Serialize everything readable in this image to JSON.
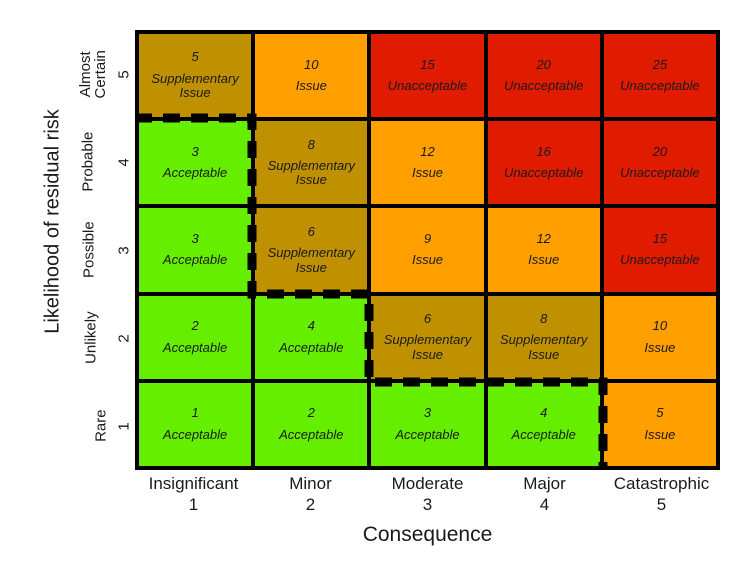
{
  "figure": {
    "y_axis_title": "Likelihood of residual risk",
    "x_axis_title": "Consequence"
  },
  "chart_data": {
    "type": "heatmap",
    "title": "",
    "xlabel": "Consequence",
    "ylabel": "Likelihood of residual risk",
    "grid": true,
    "legend": "none",
    "x_categories": [
      "Insignificant",
      "Minor",
      "Moderate",
      "Major",
      "Catastrophic"
    ],
    "x_values": [
      "1",
      "2",
      "3",
      "4",
      "5"
    ],
    "y_categories": [
      "Almost\nCertain",
      "Probable",
      "Possible",
      "Unlikely",
      "Rare"
    ],
    "y_values": [
      "5",
      "4",
      "3",
      "2",
      "1"
    ],
    "colors": {
      "acceptable": "#66ee00",
      "supplementary_issue": "#bf9000",
      "issue": "#ffa000",
      "unacceptable": "#e01b00",
      "grid_line": "#000000",
      "boundary_line": "#000000"
    },
    "rows": [
      {
        "likelihood": "Almost Certain",
        "likelihood_value": "5",
        "cells": [
          {
            "score": "5",
            "verdict": "Supplementary\nIssue",
            "level": "supplementary_issue"
          },
          {
            "score": "10",
            "verdict": "Issue",
            "level": "issue"
          },
          {
            "score": "15",
            "verdict": "Unacceptable",
            "level": "unacceptable"
          },
          {
            "score": "20",
            "verdict": "Unacceptable",
            "level": "unacceptable"
          },
          {
            "score": "25",
            "verdict": "Unacceptable",
            "level": "unacceptable"
          }
        ]
      },
      {
        "likelihood": "Probable",
        "likelihood_value": "4",
        "cells": [
          {
            "score": "3",
            "verdict": "Acceptable",
            "level": "acceptable"
          },
          {
            "score": "8",
            "verdict": "Supplementary\nIssue",
            "level": "supplementary_issue"
          },
          {
            "score": "12",
            "verdict": "Issue",
            "level": "issue"
          },
          {
            "score": "16",
            "verdict": "Unacceptable",
            "level": "unacceptable"
          },
          {
            "score": "20",
            "verdict": "Unacceptable",
            "level": "unacceptable"
          }
        ]
      },
      {
        "likelihood": "Possible",
        "likelihood_value": "3",
        "cells": [
          {
            "score": "3",
            "verdict": "Acceptable",
            "level": "acceptable"
          },
          {
            "score": "6",
            "verdict": "Supplementary\nIssue",
            "level": "supplementary_issue"
          },
          {
            "score": "9",
            "verdict": "Issue",
            "level": "issue"
          },
          {
            "score": "12",
            "verdict": "Issue",
            "level": "issue"
          },
          {
            "score": "15",
            "verdict": "Unacceptable",
            "level": "unacceptable"
          }
        ]
      },
      {
        "likelihood": "Unlikely",
        "likelihood_value": "2",
        "cells": [
          {
            "score": "2",
            "verdict": "Acceptable",
            "level": "acceptable"
          },
          {
            "score": "4",
            "verdict": "Acceptable",
            "level": "acceptable"
          },
          {
            "score": "6",
            "verdict": "Supplementary\nIssue",
            "level": "supplementary_issue"
          },
          {
            "score": "8",
            "verdict": "Supplementary\nIssue",
            "level": "supplementary_issue"
          },
          {
            "score": "10",
            "verdict": "Issue",
            "level": "issue"
          }
        ]
      },
      {
        "likelihood": "Rare",
        "likelihood_value": "1",
        "cells": [
          {
            "score": "1",
            "verdict": "Acceptable",
            "level": "acceptable"
          },
          {
            "score": "2",
            "verdict": "Acceptable",
            "level": "acceptable"
          },
          {
            "score": "3",
            "verdict": "Acceptable",
            "level": "acceptable"
          },
          {
            "score": "4",
            "verdict": "Acceptable",
            "level": "acceptable"
          },
          {
            "score": "5",
            "verdict": "Issue",
            "level": "issue"
          }
        ]
      }
    ],
    "annotations": [
      {
        "name": "acceptability-boundary",
        "style": "dashed",
        "description": "Dashed staircase outlining the Acceptable (green) region"
      }
    ]
  }
}
